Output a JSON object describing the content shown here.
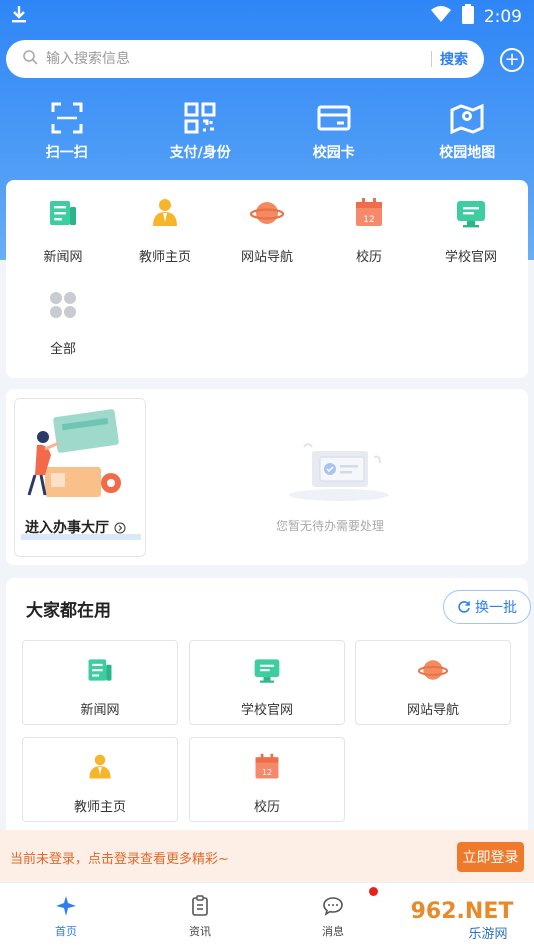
{
  "status_bar": {
    "time": "2:09",
    "download_icon": "download-icon",
    "wifi_icon": "wifi-icon",
    "battery_icon": "battery-icon"
  },
  "search": {
    "placeholder": "输入搜索信息",
    "button_label": "搜索",
    "icon": "search-icon",
    "add_icon": "plus-circle-icon"
  },
  "quick_actions": [
    {
      "label": "扫一扫",
      "icon": "scan-icon"
    },
    {
      "label": "支付/身份",
      "icon": "qr-code-icon"
    },
    {
      "label": "校园卡",
      "icon": "card-icon"
    },
    {
      "label": "校园地图",
      "icon": "map-icon"
    }
  ],
  "apps": [
    {
      "label": "新闻网",
      "icon": "news-icon"
    },
    {
      "label": "教师主页",
      "icon": "teacher-icon"
    },
    {
      "label": "网站导航",
      "icon": "planet-icon"
    },
    {
      "label": "校历",
      "icon": "calendar-icon",
      "calendar_day": "12"
    },
    {
      "label": "学校官网",
      "icon": "monitor-icon"
    },
    {
      "label": "全部",
      "icon": "grid-all-icon"
    }
  ],
  "todo": {
    "hall_label": "进入办事大厅",
    "empty_text": "您暂无待办需要处理"
  },
  "popular": {
    "title": "大家都在用",
    "swap_label": "换一批",
    "items": [
      {
        "label": "新闻网",
        "icon": "news-icon"
      },
      {
        "label": "学校官网",
        "icon": "monitor-icon"
      },
      {
        "label": "网站导航",
        "icon": "planet-icon"
      },
      {
        "label": "教师主页",
        "icon": "teacher-icon"
      },
      {
        "label": "校历",
        "icon": "calendar-icon",
        "calendar_day": "12"
      }
    ]
  },
  "login_banner": {
    "text": "当前未登录，点击登录查看更多精彩~",
    "button_label": "立即登录"
  },
  "tabs": [
    {
      "label": "首页",
      "icon": "plane-icon",
      "active": true
    },
    {
      "label": "资讯",
      "icon": "clipboard-icon",
      "active": false
    },
    {
      "label": "消息",
      "icon": "chat-icon",
      "active": false
    }
  ],
  "watermark": {
    "text": "962.NET",
    "subtext": "乐游网"
  },
  "colors": {
    "accent": "#2f7ef0",
    "header": "#3a8cf6",
    "login_orange": "#f07a2c"
  }
}
